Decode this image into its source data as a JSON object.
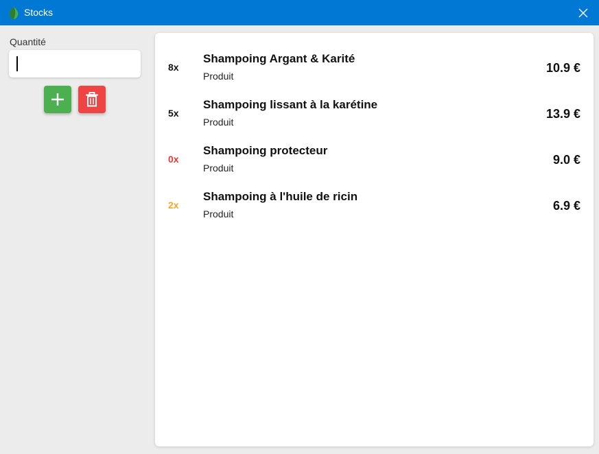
{
  "window": {
    "title": "Stocks",
    "accent": "#0078d4"
  },
  "form": {
    "quantity_label": "Quantité",
    "quantity_value": "",
    "add_icon": "plus-icon",
    "delete_icon": "trash-icon",
    "add_color": "#4caf50",
    "delete_color": "#ef4444"
  },
  "products": [
    {
      "qty": "8x",
      "qty_color": "#111111",
      "name": "Shampoing Argant & Karité",
      "subtitle": "Produit",
      "price": "10.9 €"
    },
    {
      "qty": "5x",
      "qty_color": "#111111",
      "name": "Shampoing lissant à la karétine",
      "subtitle": "Produit",
      "price": "13.9 €"
    },
    {
      "qty": "0x",
      "qty_color": "#e53935",
      "name": "Shampoing protecteur",
      "subtitle": "Produit",
      "price": "9.0 €"
    },
    {
      "qty": "2x",
      "qty_color": "#f5a623",
      "name": "Shampoing à l'huile de ricin",
      "subtitle": "Produit",
      "price": "6.9 €"
    }
  ]
}
